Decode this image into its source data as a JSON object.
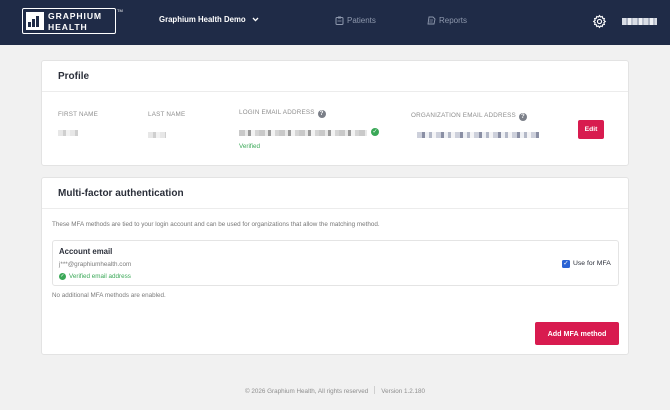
{
  "header": {
    "logo_line1": "GRAPHIUM",
    "logo_line2": "HEALTH",
    "logo_tm": "TM",
    "org_name": "Graphium Health Demo",
    "nav": [
      {
        "label": "Patients",
        "icon": "clipboard-icon"
      },
      {
        "label": "Reports",
        "icon": "document-icon"
      }
    ],
    "settings_icon": "gear-icon",
    "colors": {
      "bar": "#1f2b47",
      "nav_text": "#8e98ad"
    }
  },
  "profile": {
    "title": "Profile",
    "first_name_label": "FIRST NAME",
    "last_name_label": "LAST NAME",
    "login_email_label": "LOGIN EMAIL ADDRESS",
    "login_email_status": "Verified",
    "org_email_label": "ORGANIZATION EMAIL ADDRESS",
    "edit_label": "Edit"
  },
  "mfa": {
    "title": "Multi-factor authentication",
    "description": "These MFA methods are tied to your login account and can be used for organizations that allow the matching method.",
    "methods": [
      {
        "title": "Account email",
        "email": "j***@graphiumhealth.com",
        "status": "Verified email address",
        "use_for_mfa_label": "Use for MFA",
        "use_for_mfa": true
      }
    ],
    "none_note": "No additional MFA methods are enabled.",
    "add_label": "Add MFA method"
  },
  "footer": {
    "copyright": "© 2026 Graphium Health, All rights reserved",
    "version": "Version 1.2.180"
  },
  "colors": {
    "accent": "#d81b4f",
    "success": "#3aa857",
    "page_bg": "#f1f1f1"
  }
}
